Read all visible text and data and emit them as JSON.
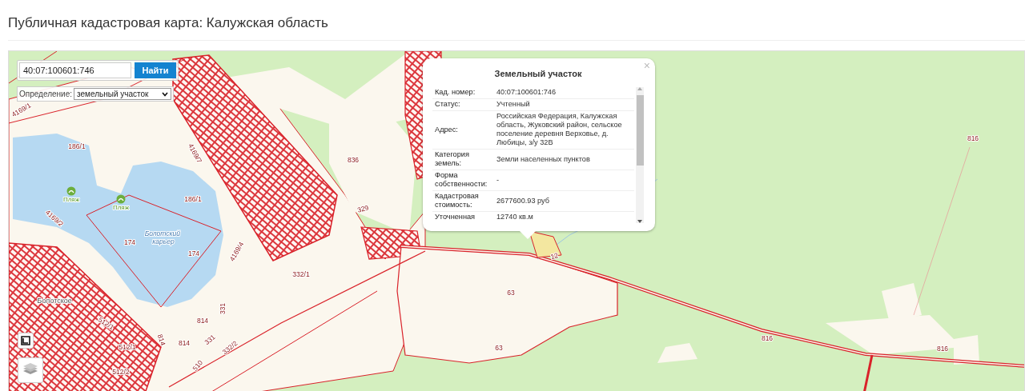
{
  "page_title": "Публичная кадастровая карта: Калужская область",
  "search": {
    "value": "40:07:100601:746",
    "button": "Найти"
  },
  "definition": {
    "label": "Определение:",
    "value": "земельный участок"
  },
  "popup": {
    "title": "Земельный участок",
    "close": "×",
    "rows": [
      {
        "label": "Кад. номер:",
        "value": "40:07:100601:746"
      },
      {
        "label": "Статус:",
        "value": "Учтенный"
      },
      {
        "label": "Адрес:",
        "value": "Российская Федерация, Калужская область, Жуковский район, сельское поселение деревня Верховье, д. Любицы, з/у 32В"
      },
      {
        "label": "Категория земель:",
        "value": "Земли населенных пунктов"
      },
      {
        "label": "Форма собственности:",
        "value": "-"
      },
      {
        "label": "Кадастровая стоимость:",
        "value": "2677600.93 руб"
      },
      {
        "label": "Уточненная",
        "value": "12740 кв.м"
      }
    ]
  },
  "map_labels": [
    {
      "text": "4169/1",
      "kind": "parcel"
    },
    {
      "text": "186/1",
      "kind": "parcel"
    },
    {
      "text": "Пляж",
      "kind": "poi"
    },
    {
      "text": "Пляж",
      "kind": "poi"
    },
    {
      "text": "186/1",
      "kind": "parcel"
    },
    {
      "text": "4169/7",
      "kind": "parcel"
    },
    {
      "text": "4169/2",
      "kind": "parcel"
    },
    {
      "text": "174",
      "kind": "parcel"
    },
    {
      "text": "Болотский карьер",
      "kind": "water"
    },
    {
      "text": "174",
      "kind": "parcel"
    },
    {
      "text": "4169/4",
      "kind": "parcel"
    },
    {
      "text": "836",
      "kind": "parcel"
    },
    {
      "text": "329",
      "kind": "parcel"
    },
    {
      "text": "332/1",
      "kind": "parcel"
    },
    {
      "text": "331",
      "kind": "parcel"
    },
    {
      "text": "Болотское",
      "kind": "place"
    },
    {
      "text": "512/1",
      "kind": "parcel"
    },
    {
      "text": "814",
      "kind": "parcel"
    },
    {
      "text": "512/1",
      "kind": "parcel"
    },
    {
      "text": "814",
      "kind": "parcel"
    },
    {
      "text": "814",
      "kind": "parcel"
    },
    {
      "text": "331",
      "kind": "parcel"
    },
    {
      "text": "332/2",
      "kind": "parcel"
    },
    {
      "text": "512/2",
      "kind": "parcel"
    },
    {
      "text": "510",
      "kind": "parcel"
    },
    {
      "text": "816",
      "kind": "parcel"
    },
    {
      "text": "12",
      "kind": "parcel"
    },
    {
      "text": "63",
      "kind": "parcel"
    },
    {
      "text": "63",
      "kind": "parcel"
    },
    {
      "text": "816",
      "kind": "parcel"
    },
    {
      "text": "816",
      "kind": "parcel"
    }
  ]
}
